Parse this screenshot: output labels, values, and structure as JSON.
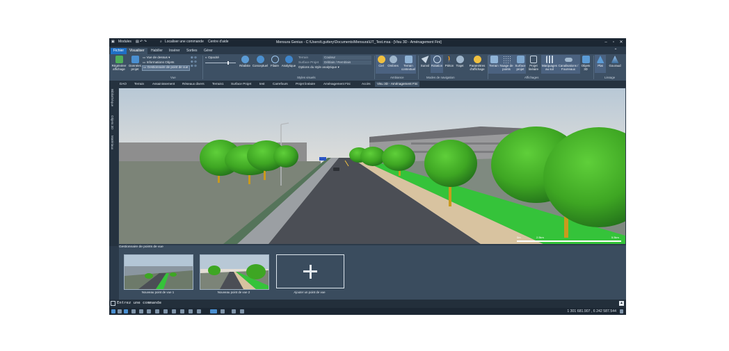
{
  "quick_access": {
    "modules_label": "Modules",
    "command_search": "Localiser une commande",
    "help_center": "Centre d'aide"
  },
  "window": {
    "title": "Mensura Genius - C:\\Users\\t.guttery\\Documents\\Mensura\\UT_Test.msa - [Visu 3D - Aménagement Fini]"
  },
  "ribbon_tabs": [
    "Fichier",
    "Visualiser",
    "Habiller",
    "Insérer",
    "Sorties",
    "Gérer"
  ],
  "ribbon": {
    "vue": {
      "regenerate": "Régénérer affichage",
      "project_data": "Données projet",
      "top_view": "Vue de dessus",
      "object_info": "Informations Objets",
      "viewpoint_manager": "Gestionnaire de point de vue",
      "group_label": "Vue"
    },
    "styles": {
      "opacity": "Opacité",
      "realiste": "Réaliste",
      "conceptuel": "Conceptuel",
      "filaire": "Filaire",
      "analytique": "Analytique",
      "terrain": "Terrain",
      "terrain_value": "Couleur",
      "surface_projet": "Surface Projet",
      "surface_value": "Déblais / Remblais",
      "analytic_options": "Options du style analytique",
      "group_label": "Styles visuels"
    },
    "ambiance": {
      "ciel": "Ciel",
      "ombres": "Ombres",
      "terrain_contextuel": "Terrain contextuel",
      "group_label": "Ambiance"
    },
    "navigation": {
      "survol": "Survol",
      "rotation": "Rotation",
      "pieton": "Piéton",
      "trajet": "Trajet",
      "group_label": "Modes de navigation"
    },
    "display_params": "Paramètres d'affichage",
    "affichages": {
      "terrain": "Terrain",
      "nuage": "Nuage de points",
      "surface_projet": "Surface projet",
      "projet_lineaire": "Projet linéaire",
      "marquages": "Marquages au sol",
      "canalisations": "Canalisations / Fourreaux",
      "objets3d": "Objets 3D",
      "group_label": "Affichages"
    },
    "lissage": {
      "plat": "Plat",
      "gouraud": "Gouraud",
      "group_label": "Lissage"
    }
  },
  "doc_tabs": [
    "DAO",
    "Terrain",
    "Assainissement",
    "Réseaux divers",
    "Terrain1",
    "Surface Projet",
    "test",
    "Carrefours",
    "Projet linéaire",
    "Aménagement Fini",
    "Accès",
    "Visu 3D - Aménagement Fini"
  ],
  "side_tabs": [
    "Bibliothèque",
    "Objets 3D",
    "Matériaux"
  ],
  "viewport": {
    "scale_label_start": "0m",
    "scale_label_mid": "2.5km",
    "scale_label_end": "5.5km"
  },
  "viewpoint_panel": {
    "title": "Gestionnaire de points de vue",
    "items": [
      {
        "label": "Nouveau point de vue 1"
      },
      {
        "label": "Nouveau point de vue 2"
      }
    ],
    "add_label": "Ajouter un point de vue"
  },
  "command_line": {
    "placeholder": "Entrez une commande"
  },
  "status": {
    "coordinates": "1 301 681.907 , 6 242 587.544"
  },
  "colors": {
    "accent": "#1f6fc5",
    "ribbon_bg": "#3d5064",
    "chrome_bg": "#1c2733"
  }
}
